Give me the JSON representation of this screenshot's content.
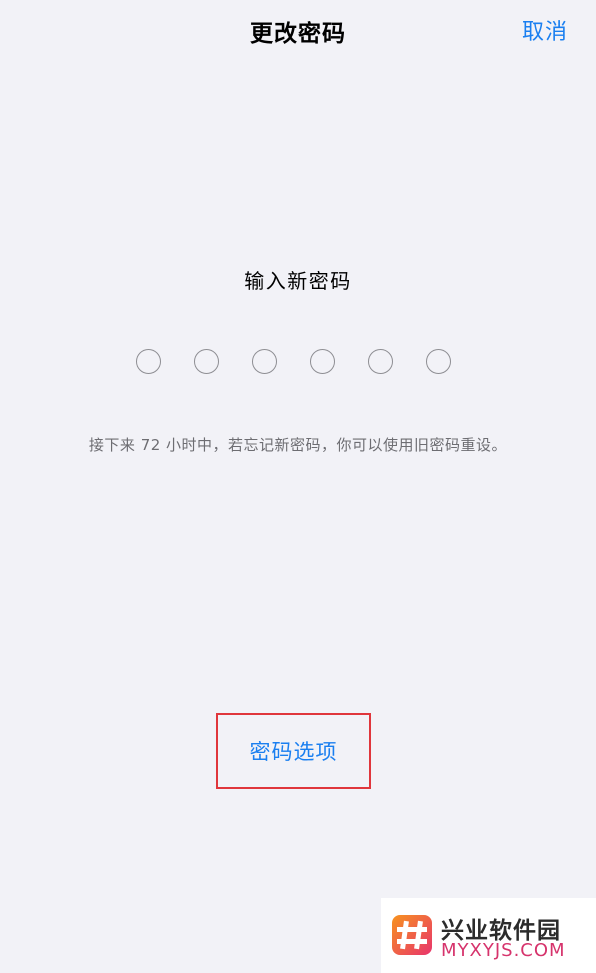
{
  "nav": {
    "title": "更改密码",
    "cancel_label": "取消"
  },
  "passcode": {
    "prompt": "输入新密码",
    "length": 6,
    "entered": 0,
    "hint": "接下来 72 小时中，若忘记新密码，你可以使用旧密码重设。"
  },
  "options": {
    "label": "密码选项"
  },
  "colors": {
    "accent": "#1a7ff0",
    "background": "#f2f2f7",
    "highlight_box": "#e0363c"
  },
  "watermark": {
    "name": "兴业软件园",
    "domain": "MYXYJS.COM"
  }
}
